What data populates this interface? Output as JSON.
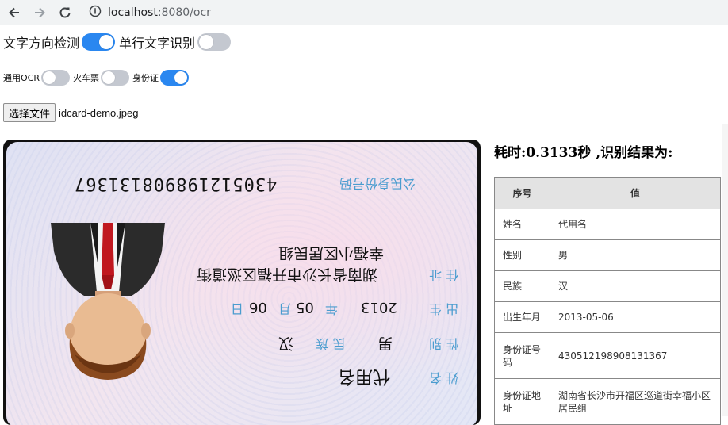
{
  "browser": {
    "url_host": "localhost",
    "url_rest": ":8080/ocr"
  },
  "toggles_top": [
    {
      "label": "文字方向检测",
      "on": true
    },
    {
      "label": "单行文字识别",
      "on": false
    }
  ],
  "toggles_mode": [
    {
      "label": "通用OCR",
      "on": false
    },
    {
      "label": "火车票",
      "on": false
    },
    {
      "label": "身份证",
      "on": true
    }
  ],
  "file": {
    "button_label": "选择文件",
    "file_name": "idcard-demo.jpeg"
  },
  "card": {
    "id_number": "430512198908131367",
    "id_label": "公民身份号码",
    "address_label": "住 址",
    "address_line1": "湖南省长沙市开福区巡道街",
    "address_line2": "幸福小区居民组",
    "birth_label": "出 生",
    "birth_year": "2013",
    "birth_year_unit": "年",
    "birth_month": "05",
    "birth_month_unit": "月",
    "birth_day": "06",
    "birth_day_unit": "日",
    "sex_label": "性 别",
    "sex_value": "男",
    "ethnic_label": "民 族",
    "ethnic_value": "汉",
    "name_label": "姓 名",
    "name_value": "代用名"
  },
  "result": {
    "title": "耗时:0.3133秒 ,识别结果为:",
    "headers": [
      "序号",
      "值"
    ],
    "rows": [
      {
        "key": "姓名",
        "value": "代用名"
      },
      {
        "key": "性别",
        "value": "男"
      },
      {
        "key": "民族",
        "value": "汉"
      },
      {
        "key": "出生年月",
        "value": "2013-05-06"
      },
      {
        "key": "身份证号码",
        "value": "430512198908131367"
      },
      {
        "key": "身份证地址",
        "value": "湖南省长沙市开福区巡道街幸福小区居民组"
      }
    ]
  }
}
